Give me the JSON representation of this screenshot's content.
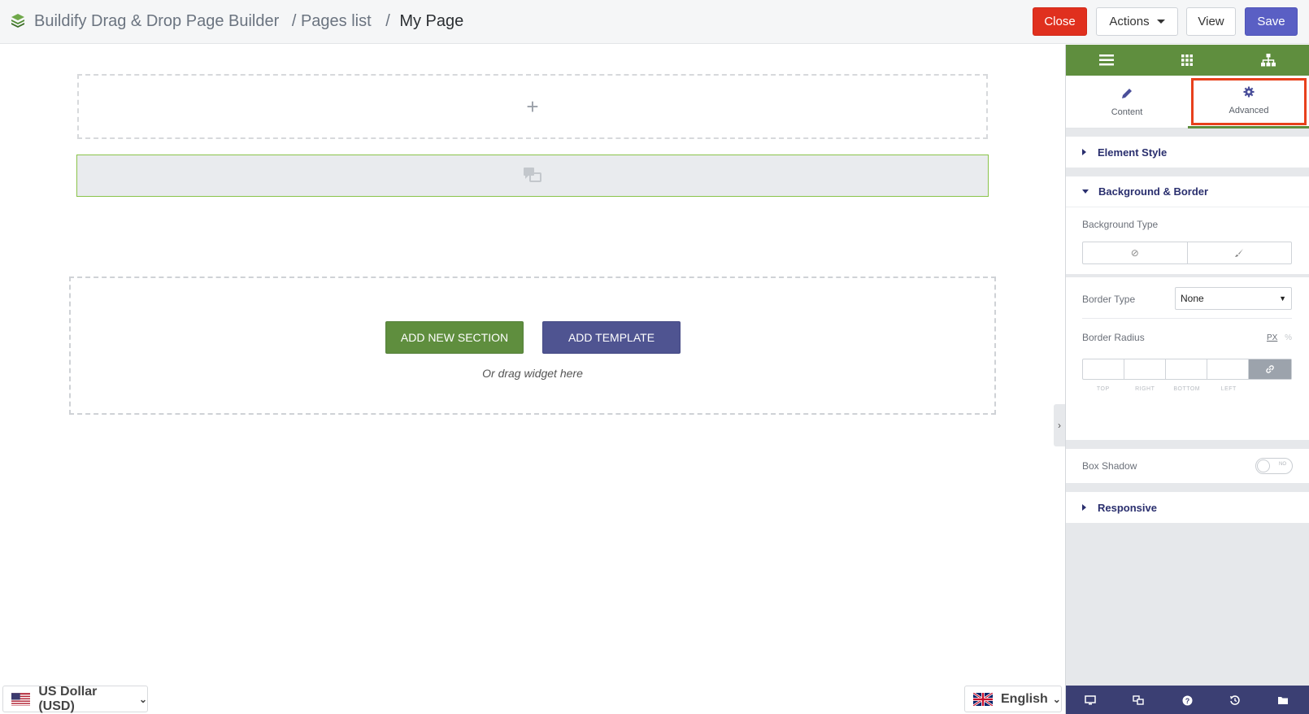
{
  "header": {
    "app_name": "Buildify Drag & Drop Page Builder",
    "crumb_pages": "/ Pages list",
    "crumb_sep": "/",
    "crumb_current": "My Page",
    "close_label": "Close",
    "actions_label": "Actions",
    "view_label": "View",
    "save_label": "Save"
  },
  "canvas": {
    "add_icon": "+",
    "add_section_label": "ADD NEW SECTION",
    "add_template_label": "ADD TEMPLATE",
    "drag_hint": "Or drag widget here"
  },
  "footer": {
    "currency": "US Dollar (USD)",
    "language": "English"
  },
  "panel": {
    "tabs": [
      {
        "label": "Content",
        "icon": "pencil-icon"
      },
      {
        "label": "Advanced",
        "icon": "gear-icon"
      }
    ],
    "sections": {
      "element_style": "Element Style",
      "background_border": "Background & Border",
      "responsive": "Responsive"
    },
    "background_type_label": "Background Type",
    "border_type_label": "Border Type",
    "border_type_value": "None",
    "border_radius_label": "Border Radius",
    "unit_px": "PX",
    "unit_pct": "%",
    "radius_sides": [
      "TOP",
      "RIGHT",
      "BOTTOM",
      "LEFT"
    ],
    "box_shadow_label": "Box Shadow",
    "box_shadow_toggle": "NO"
  },
  "colors": {
    "brand_green": "#5f8e3e",
    "brand_purple": "#4f5491",
    "danger": "#e0301e",
    "highlight": "#e8401c"
  }
}
